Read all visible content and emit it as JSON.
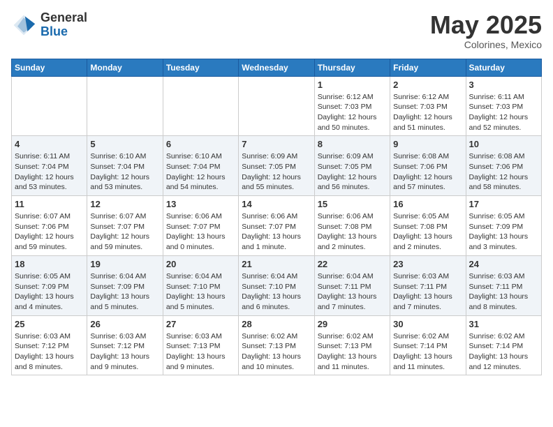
{
  "header": {
    "logo_general": "General",
    "logo_blue": "Blue",
    "month_title": "May 2025",
    "location": "Colorines, Mexico"
  },
  "weekdays": [
    "Sunday",
    "Monday",
    "Tuesday",
    "Wednesday",
    "Thursday",
    "Friday",
    "Saturday"
  ],
  "weeks": [
    [
      {
        "day": "",
        "info": ""
      },
      {
        "day": "",
        "info": ""
      },
      {
        "day": "",
        "info": ""
      },
      {
        "day": "",
        "info": ""
      },
      {
        "day": "1",
        "info": "Sunrise: 6:12 AM\nSunset: 7:03 PM\nDaylight: 12 hours and 50 minutes."
      },
      {
        "day": "2",
        "info": "Sunrise: 6:12 AM\nSunset: 7:03 PM\nDaylight: 12 hours and 51 minutes."
      },
      {
        "day": "3",
        "info": "Sunrise: 6:11 AM\nSunset: 7:03 PM\nDaylight: 12 hours and 52 minutes."
      }
    ],
    [
      {
        "day": "4",
        "info": "Sunrise: 6:11 AM\nSunset: 7:04 PM\nDaylight: 12 hours and 53 minutes."
      },
      {
        "day": "5",
        "info": "Sunrise: 6:10 AM\nSunset: 7:04 PM\nDaylight: 12 hours and 53 minutes."
      },
      {
        "day": "6",
        "info": "Sunrise: 6:10 AM\nSunset: 7:04 PM\nDaylight: 12 hours and 54 minutes."
      },
      {
        "day": "7",
        "info": "Sunrise: 6:09 AM\nSunset: 7:05 PM\nDaylight: 12 hours and 55 minutes."
      },
      {
        "day": "8",
        "info": "Sunrise: 6:09 AM\nSunset: 7:05 PM\nDaylight: 12 hours and 56 minutes."
      },
      {
        "day": "9",
        "info": "Sunrise: 6:08 AM\nSunset: 7:06 PM\nDaylight: 12 hours and 57 minutes."
      },
      {
        "day": "10",
        "info": "Sunrise: 6:08 AM\nSunset: 7:06 PM\nDaylight: 12 hours and 58 minutes."
      }
    ],
    [
      {
        "day": "11",
        "info": "Sunrise: 6:07 AM\nSunset: 7:06 PM\nDaylight: 12 hours and 59 minutes."
      },
      {
        "day": "12",
        "info": "Sunrise: 6:07 AM\nSunset: 7:07 PM\nDaylight: 12 hours and 59 minutes."
      },
      {
        "day": "13",
        "info": "Sunrise: 6:06 AM\nSunset: 7:07 PM\nDaylight: 13 hours and 0 minutes."
      },
      {
        "day": "14",
        "info": "Sunrise: 6:06 AM\nSunset: 7:07 PM\nDaylight: 13 hours and 1 minute."
      },
      {
        "day": "15",
        "info": "Sunrise: 6:06 AM\nSunset: 7:08 PM\nDaylight: 13 hours and 2 minutes."
      },
      {
        "day": "16",
        "info": "Sunrise: 6:05 AM\nSunset: 7:08 PM\nDaylight: 13 hours and 2 minutes."
      },
      {
        "day": "17",
        "info": "Sunrise: 6:05 AM\nSunset: 7:09 PM\nDaylight: 13 hours and 3 minutes."
      }
    ],
    [
      {
        "day": "18",
        "info": "Sunrise: 6:05 AM\nSunset: 7:09 PM\nDaylight: 13 hours and 4 minutes."
      },
      {
        "day": "19",
        "info": "Sunrise: 6:04 AM\nSunset: 7:09 PM\nDaylight: 13 hours and 5 minutes."
      },
      {
        "day": "20",
        "info": "Sunrise: 6:04 AM\nSunset: 7:10 PM\nDaylight: 13 hours and 5 minutes."
      },
      {
        "day": "21",
        "info": "Sunrise: 6:04 AM\nSunset: 7:10 PM\nDaylight: 13 hours and 6 minutes."
      },
      {
        "day": "22",
        "info": "Sunrise: 6:04 AM\nSunset: 7:11 PM\nDaylight: 13 hours and 7 minutes."
      },
      {
        "day": "23",
        "info": "Sunrise: 6:03 AM\nSunset: 7:11 PM\nDaylight: 13 hours and 7 minutes."
      },
      {
        "day": "24",
        "info": "Sunrise: 6:03 AM\nSunset: 7:11 PM\nDaylight: 13 hours and 8 minutes."
      }
    ],
    [
      {
        "day": "25",
        "info": "Sunrise: 6:03 AM\nSunset: 7:12 PM\nDaylight: 13 hours and 8 minutes."
      },
      {
        "day": "26",
        "info": "Sunrise: 6:03 AM\nSunset: 7:12 PM\nDaylight: 13 hours and 9 minutes."
      },
      {
        "day": "27",
        "info": "Sunrise: 6:03 AM\nSunset: 7:13 PM\nDaylight: 13 hours and 9 minutes."
      },
      {
        "day": "28",
        "info": "Sunrise: 6:02 AM\nSunset: 7:13 PM\nDaylight: 13 hours and 10 minutes."
      },
      {
        "day": "29",
        "info": "Sunrise: 6:02 AM\nSunset: 7:13 PM\nDaylight: 13 hours and 11 minutes."
      },
      {
        "day": "30",
        "info": "Sunrise: 6:02 AM\nSunset: 7:14 PM\nDaylight: 13 hours and 11 minutes."
      },
      {
        "day": "31",
        "info": "Sunrise: 6:02 AM\nSunset: 7:14 PM\nDaylight: 13 hours and 12 minutes."
      }
    ]
  ]
}
